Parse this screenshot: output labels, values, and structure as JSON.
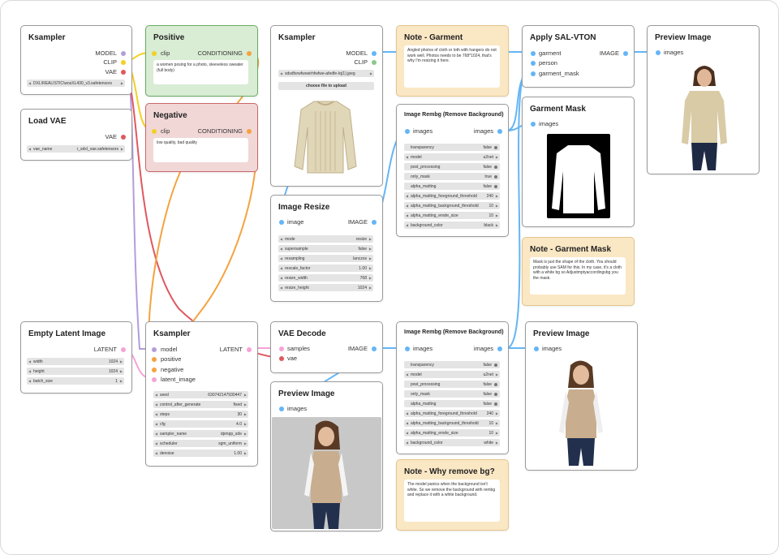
{
  "nodes": {
    "ksampler_loader": {
      "title": "Ksampler",
      "out_model": "MODEL",
      "out_clip": "CLIP",
      "out_vae": "VAE",
      "ckpt": "DXL\\REALISTIC\\wosXL430_v3.safetensors"
    },
    "load_vae": {
      "title": "Load VAE",
      "out_vae": "VAE",
      "vae_label": "vae_name",
      "vae_value": "r_sdxl_vae.safetensors"
    },
    "positive": {
      "title": "Positive",
      "in_clip": "clip",
      "out": "CONDITIONING",
      "text": "a women posing for a photo, sleeveless sweater (full body)"
    },
    "negative": {
      "title": "Negative",
      "in_clip": "clip",
      "out": "CONDITIONING",
      "text": "low quality, bad quality"
    },
    "ksampler_image": {
      "title": "Ksampler",
      "out_model": "MODEL",
      "out_clip": "CLIP",
      "file": "sdsdfsrwfwoeirhfwfwe-afedfe-lq(1).jpeg",
      "upload": "choose file to upload"
    },
    "image_resize": {
      "title": "Image Resize",
      "in_image": "image",
      "out_image": "IMAGE",
      "widgets": [
        [
          "mode",
          "resize"
        ],
        [
          "supersample",
          "false"
        ],
        [
          "resampling",
          "lanczos"
        ],
        [
          "rescale_factor",
          "1.00"
        ],
        [
          "resize_width",
          "768"
        ],
        [
          "resize_height",
          "1024"
        ]
      ]
    },
    "note_garment": {
      "title": "Note - Garment",
      "text": "Angled photos of cloth or loth with hangers do not work well. Photos needs to be 768*1024, that's why I'm resizing it here."
    },
    "rembg1": {
      "title": "Image Rembg (Remove Background)",
      "in_images": "images",
      "out_images": "images",
      "widgets": [
        [
          "transparency",
          "false"
        ],
        [
          "model",
          "u2net"
        ],
        [
          "post_processing",
          "false"
        ],
        [
          "only_mask",
          "true"
        ],
        [
          "alpha_matting",
          "false"
        ],
        [
          "alpha_matting_foreground_threshold",
          "240"
        ],
        [
          "alpha_matting_background_threshold",
          "10"
        ],
        [
          "alpha_matting_erode_size",
          "10"
        ],
        [
          "background_color",
          "black"
        ]
      ]
    },
    "apply_salvton": {
      "title": "Apply SAL-VTON",
      "in_garment": "garment",
      "in_person": "person",
      "in_mask": "garment_mask",
      "out_image": "IMAGE"
    },
    "garment_mask": {
      "title": "Garment Mask",
      "in_images": "images"
    },
    "preview1": {
      "title": "Preview Image",
      "in_images": "images"
    },
    "note_mask": {
      "title": "Note - Garment Mask",
      "text": "Mask is just the shape of the cloth. You should probably use SAM for this. In my case, it's a cloth with a white bg so Adjustmptyaccordingsbg you the mask."
    },
    "empty_latent": {
      "title": "Empty Latent Image",
      "out_latent": "LATENT",
      "widgets": [
        [
          "width",
          "1024"
        ],
        [
          "height",
          "1024"
        ],
        [
          "batch_size",
          "1"
        ]
      ]
    },
    "ksampler_main": {
      "title": "Ksampler",
      "in_model": "model",
      "in_positive": "positive",
      "in_negative": "negative",
      "in_latent": "latent_image",
      "out_latent": "LATENT",
      "widgets": [
        [
          "seed",
          "630742147930447"
        ],
        [
          "control_after_generate",
          "fixed"
        ],
        [
          "steps",
          "30"
        ],
        [
          "cfg",
          "4.0"
        ],
        [
          "sampler_name",
          "dpmpp_sde"
        ],
        [
          "scheduler",
          "sgm_uniform"
        ],
        [
          "denoise",
          "1.00"
        ]
      ]
    },
    "vae_decode": {
      "title": "VAE Decode",
      "in_samples": "samples",
      "in_vae": "vae",
      "out_image": "IMAGE"
    },
    "preview2": {
      "title": "Preview Image",
      "in_images": "images"
    },
    "rembg2": {
      "title": "Image Rembg (Remove Background)",
      "in_images": "images",
      "out_images": "images",
      "widgets": [
        [
          "transparency",
          "false"
        ],
        [
          "model",
          "u2net"
        ],
        [
          "post_processing",
          "false"
        ],
        [
          "only_mask",
          "false"
        ],
        [
          "alpha_matting",
          "false"
        ],
        [
          "alpha_matting_foreground_threshold",
          "240"
        ],
        [
          "alpha_matting_background_threshold",
          "10"
        ],
        [
          "alpha_matting_erode_size",
          "10"
        ],
        [
          "background_color",
          "white"
        ]
      ]
    },
    "preview3": {
      "title": "Preview Image",
      "in_images": "images"
    },
    "note_bg": {
      "title": "Note - Why remove bg?",
      "text": "The model panics when the background isn't white. So we remove the background with rembg and replace it with a white background."
    }
  },
  "colors": {
    "model": "#b39ddb",
    "clip": "#f2d024",
    "vae": "#e0585f",
    "conditioning": "#f4a340",
    "image": "#64b5f6",
    "latent": "#f5a3d7",
    "mask": "#8bc98b"
  }
}
